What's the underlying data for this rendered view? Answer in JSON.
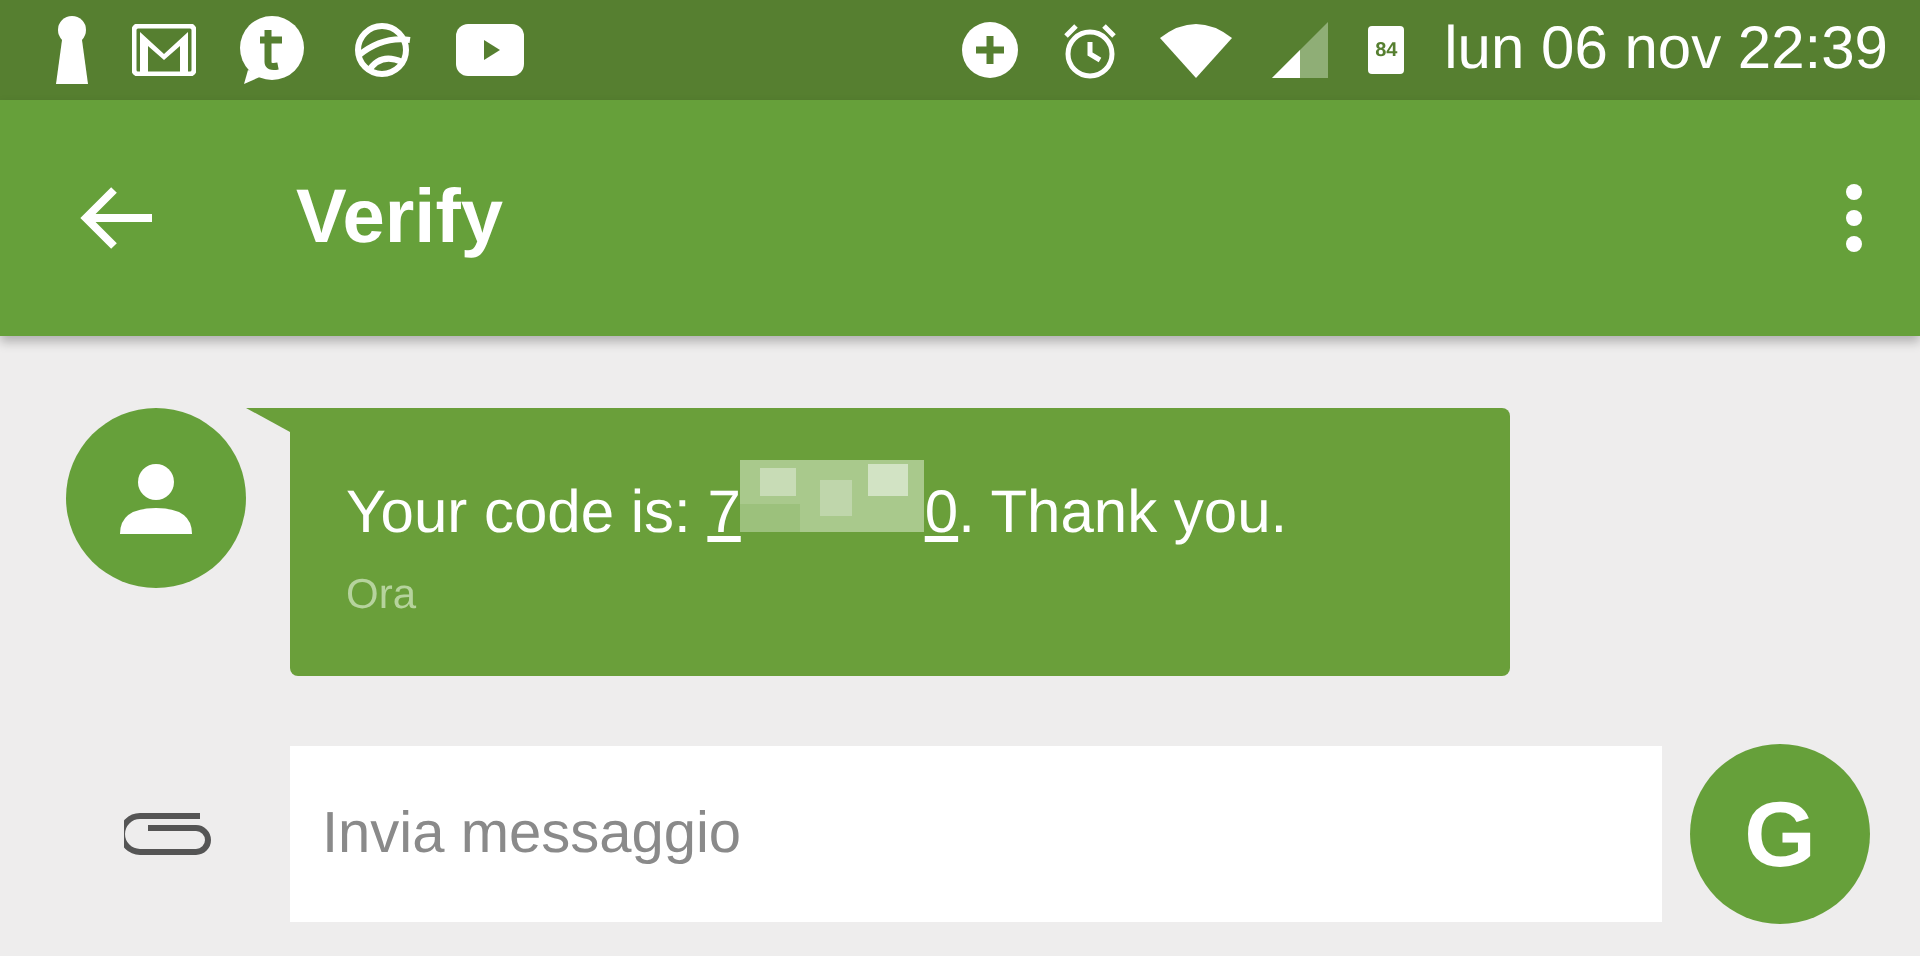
{
  "status_bar": {
    "battery": "84",
    "clock": "lun 06 nov 22:39"
  },
  "app_bar": {
    "title": "Verify"
  },
  "messages": [
    {
      "before": "Your code is: ",
      "code_start": "7",
      "code_end": "0",
      "after": ". Thank you.",
      "time": "Ora"
    }
  ],
  "composer": {
    "placeholder": "Invia messaggio",
    "avatar_letter": "G"
  }
}
